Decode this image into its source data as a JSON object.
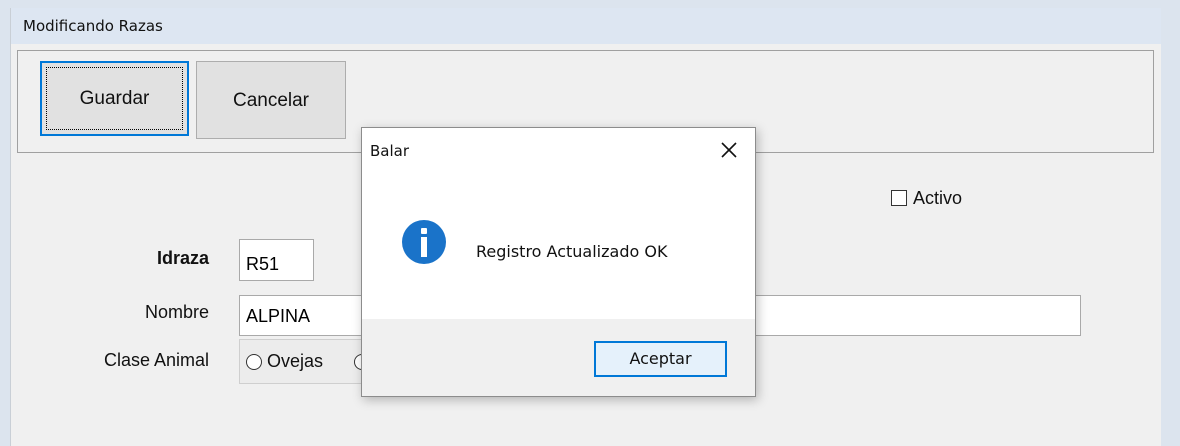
{
  "window": {
    "title": "Modificando Razas"
  },
  "toolbar": {
    "save_label": "Guardar",
    "cancel_label": "Cancelar"
  },
  "form": {
    "activo_label": "Activo",
    "activo_checked": false,
    "idraza_label": "Idraza",
    "idraza_value": "R51",
    "nombre_label": "Nombre",
    "nombre_value": "ALPINA",
    "clase_label": "Clase Animal",
    "clase_option_ovejas": "Ovejas"
  },
  "dialog": {
    "title": "Balar",
    "message": "Registro Actualizado OK",
    "ok_label": "Aceptar",
    "icon": "info-icon",
    "icon_color": "#1a73c9"
  }
}
